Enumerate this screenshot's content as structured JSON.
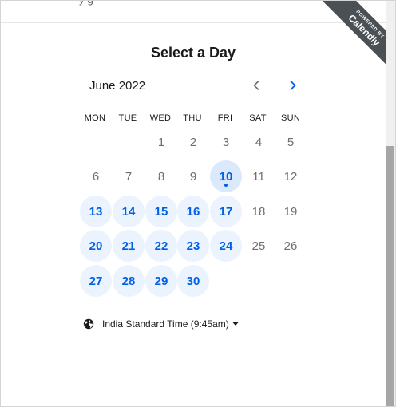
{
  "header": {
    "cut_text": "y       g"
  },
  "ribbon": {
    "powered": "POWERED BY",
    "brand": "Calendly"
  },
  "title": "Select a Day",
  "calendar": {
    "month": "June 2022",
    "weekdays": [
      "MON",
      "TUE",
      "WED",
      "THU",
      "FRI",
      "SAT",
      "SUN"
    ],
    "days": [
      {
        "label": "1",
        "state": "unavailable"
      },
      {
        "label": "2",
        "state": "unavailable"
      },
      {
        "label": "3",
        "state": "unavailable"
      },
      {
        "label": "4",
        "state": "unavailable"
      },
      {
        "label": "5",
        "state": "unavailable"
      },
      {
        "label": "6",
        "state": "unavailable"
      },
      {
        "label": "7",
        "state": "unavailable"
      },
      {
        "label": "8",
        "state": "unavailable"
      },
      {
        "label": "9",
        "state": "unavailable"
      },
      {
        "label": "10",
        "state": "today"
      },
      {
        "label": "11",
        "state": "unavailable"
      },
      {
        "label": "12",
        "state": "unavailable"
      },
      {
        "label": "13",
        "state": "available"
      },
      {
        "label": "14",
        "state": "available"
      },
      {
        "label": "15",
        "state": "available"
      },
      {
        "label": "16",
        "state": "available"
      },
      {
        "label": "17",
        "state": "available"
      },
      {
        "label": "18",
        "state": "unavailable"
      },
      {
        "label": "19",
        "state": "unavailable"
      },
      {
        "label": "20",
        "state": "available"
      },
      {
        "label": "21",
        "state": "available"
      },
      {
        "label": "22",
        "state": "available"
      },
      {
        "label": "23",
        "state": "available"
      },
      {
        "label": "24",
        "state": "available"
      },
      {
        "label": "25",
        "state": "unavailable"
      },
      {
        "label": "26",
        "state": "unavailable"
      },
      {
        "label": "27",
        "state": "available"
      },
      {
        "label": "28",
        "state": "available"
      },
      {
        "label": "29",
        "state": "available"
      },
      {
        "label": "30",
        "state": "available"
      }
    ]
  },
  "timezone": {
    "label": "India Standard Time (9:45am)"
  },
  "icons": {
    "globe": "globe-icon",
    "prev": "chevron-left-icon",
    "next": "chevron-right-icon",
    "caret": "caret-down-icon"
  },
  "colors": {
    "accent": "#0060e6",
    "available_bg": "#eaf3fe",
    "ribbon": "#4a5054"
  }
}
